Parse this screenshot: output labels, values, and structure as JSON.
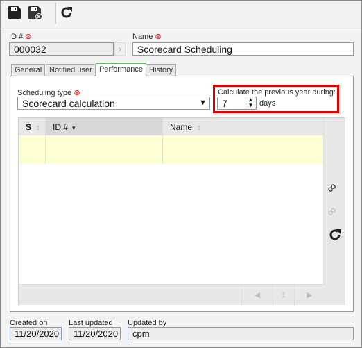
{
  "toolbar": {
    "save": "save-icon",
    "save_close": "save-close-icon",
    "refresh": "refresh-icon"
  },
  "form": {
    "id_label": "ID #",
    "id_value": "000032",
    "name_label": "Name",
    "name_value": "Scorecard Scheduling"
  },
  "tabs": [
    {
      "label": "General"
    },
    {
      "label": "Notified user"
    },
    {
      "label": "Performance",
      "active": true
    },
    {
      "label": "History"
    }
  ],
  "performance": {
    "scheduling_type_label": "Scheduling type",
    "scheduling_type_value": "Scorecard calculation",
    "calc_label": "Calculate the previous year during:",
    "calc_value": "7",
    "calc_unit": "days"
  },
  "grid": {
    "columns": [
      {
        "label": "S"
      },
      {
        "label": "ID #"
      },
      {
        "label": "Name"
      }
    ],
    "rows": [
      [
        "",
        "",
        ""
      ]
    ],
    "pager": {
      "page": "1"
    }
  },
  "footer": {
    "created_label": "Created on",
    "created_value": "11/20/2020",
    "updated_label": "Last updated",
    "updated_value": "11/20/2020",
    "updated_by_label": "Updated by",
    "updated_by_value": "cpm"
  },
  "colors": {
    "highlight": "#e00000",
    "row": "#ffffd5",
    "active_tab": "#5cb85c"
  }
}
